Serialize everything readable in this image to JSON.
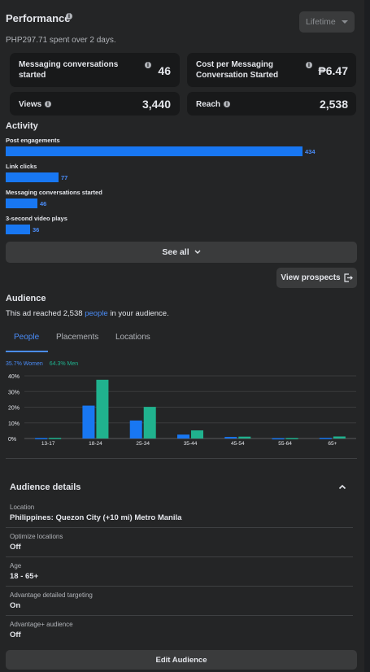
{
  "performance": {
    "title": "Performance",
    "info_icon": "info-icon",
    "range_select": "Lifetime",
    "spend_summary": "PHP297.71 spent over 2 days."
  },
  "metrics": [
    {
      "label": "Messaging conversations started",
      "value": "46"
    },
    {
      "label": "Cost per Messaging Conversation Started",
      "value": "₱6.47"
    },
    {
      "label": "Views",
      "value": "3,440"
    },
    {
      "label": "Reach",
      "value": "2,538"
    }
  ],
  "activity": {
    "title": "Activity",
    "items": [
      {
        "label": "Post engagements",
        "value": 434,
        "display": "434"
      },
      {
        "label": "Link clicks",
        "value": 77,
        "display": "77"
      },
      {
        "label": "Messaging conversations started",
        "value": 46,
        "display": "46"
      },
      {
        "label": "3-second video plays",
        "value": 36,
        "display": "36"
      }
    ],
    "see_all": "See all",
    "view_prospects": "View prospects"
  },
  "audience": {
    "title": "Audience",
    "reach_prefix": "This ad reached 2,538 ",
    "reach_link": "people",
    "reach_suffix": " in your audience.",
    "tabs": [
      "People",
      "Placements",
      "Locations"
    ],
    "active_tab": "People",
    "legend_women": "35.7% Women",
    "legend_men": "64.3% Men",
    "colors": {
      "women": "#1877f2",
      "men": "#20b28e"
    }
  },
  "chart_data": {
    "type": "bar",
    "categories": [
      "13-17",
      "18-24",
      "25-34",
      "35-44",
      "45-54",
      "55-64",
      "65+"
    ],
    "series": [
      {
        "name": "35.7% Women",
        "values": [
          0.3,
          21,
          11.5,
          2.5,
          1,
          0.2,
          0.4
        ]
      },
      {
        "name": "64.3% Men",
        "values": [
          0.4,
          37.5,
          20.2,
          5.2,
          1.2,
          0.3,
          1.3
        ]
      }
    ],
    "yticks": [
      "40%",
      "30%",
      "20%",
      "10%",
      "0%"
    ],
    "ylim": [
      0,
      40
    ],
    "grid": true
  },
  "audience_details": {
    "title": "Audience details",
    "rows": [
      {
        "label": "Location",
        "value": "Philippines: Quezon City (+10 mi) Metro Manila"
      },
      {
        "label": "Optimize locations",
        "value": "Off"
      },
      {
        "label": "Age",
        "value": "18 - 65+"
      },
      {
        "label": "Advantage detailed targeting",
        "value": "On"
      },
      {
        "label": "Advantage+ audience",
        "value": "Off"
      }
    ],
    "edit_button": "Edit Audience"
  }
}
